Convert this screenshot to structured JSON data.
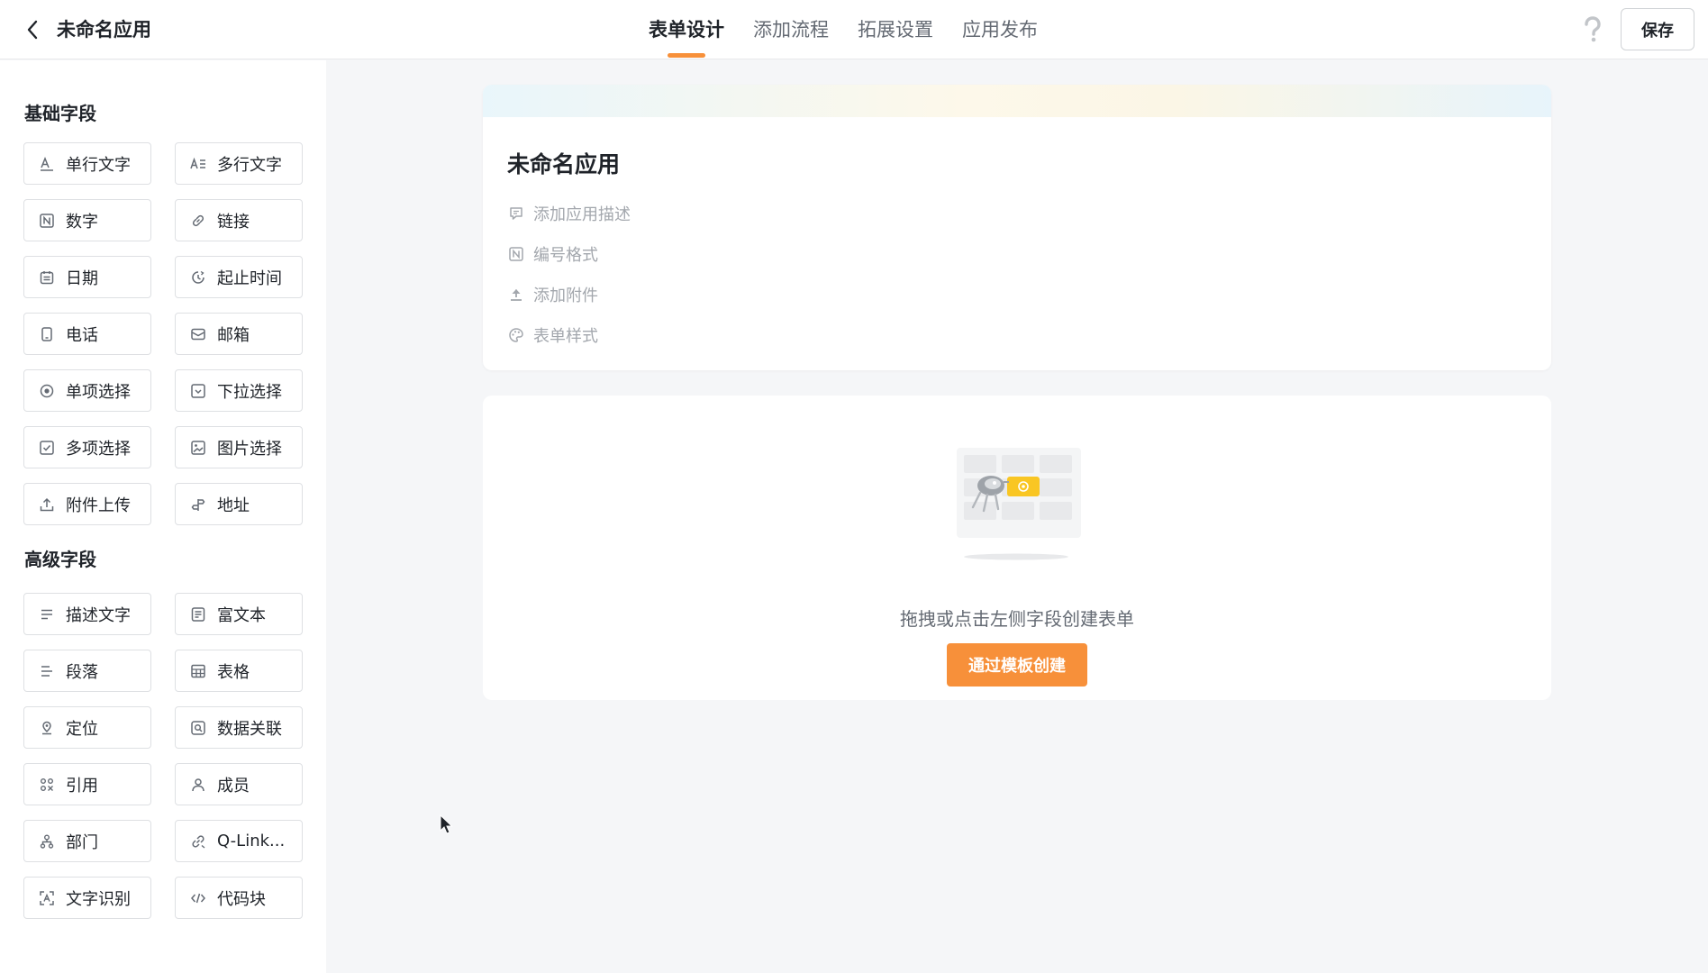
{
  "header": {
    "app_title": "未命名应用",
    "tabs": [
      {
        "label": "表单设计",
        "active": true
      },
      {
        "label": "添加流程",
        "active": false
      },
      {
        "label": "拓展设置",
        "active": false
      },
      {
        "label": "应用发布",
        "active": false
      }
    ],
    "save_label": "保存",
    "accent_color": "#f7903a"
  },
  "sidebar": {
    "basic_title": "基础字段",
    "basic_fields": [
      {
        "label": "单行文字",
        "icon": "single-line-text-icon"
      },
      {
        "label": "多行文字",
        "icon": "multi-line-text-icon"
      },
      {
        "label": "数字",
        "icon": "number-icon"
      },
      {
        "label": "链接",
        "icon": "link-icon"
      },
      {
        "label": "日期",
        "icon": "calendar-icon"
      },
      {
        "label": "起止时间",
        "icon": "time-range-icon"
      },
      {
        "label": "电话",
        "icon": "phone-icon"
      },
      {
        "label": "邮箱",
        "icon": "email-icon"
      },
      {
        "label": "单项选择",
        "icon": "radio-icon"
      },
      {
        "label": "下拉选择",
        "icon": "dropdown-icon"
      },
      {
        "label": "多项选择",
        "icon": "checkbox-icon"
      },
      {
        "label": "图片选择",
        "icon": "image-icon"
      },
      {
        "label": "附件上传",
        "icon": "upload-icon"
      },
      {
        "label": "地址",
        "icon": "address-icon"
      }
    ],
    "advanced_title": "高级字段",
    "advanced_fields": [
      {
        "label": "描述文字",
        "icon": "description-icon"
      },
      {
        "label": "富文本",
        "icon": "rich-text-icon"
      },
      {
        "label": "段落",
        "icon": "paragraph-icon"
      },
      {
        "label": "表格",
        "icon": "table-icon"
      },
      {
        "label": "定位",
        "icon": "location-icon"
      },
      {
        "label": "数据关联",
        "icon": "data-link-icon"
      },
      {
        "label": "引用",
        "icon": "reference-icon"
      },
      {
        "label": "成员",
        "icon": "member-icon"
      },
      {
        "label": "部门",
        "icon": "department-icon"
      },
      {
        "label": "Q-Link...",
        "icon": "q-link-icon"
      },
      {
        "label": "文字识别",
        "icon": "ocr-icon"
      },
      {
        "label": "代码块",
        "icon": "code-icon"
      }
    ]
  },
  "form": {
    "title": "未命名应用",
    "options": [
      {
        "label": "添加应用描述",
        "icon": "comment-icon"
      },
      {
        "label": "编号格式",
        "icon": "number-format-icon"
      },
      {
        "label": "添加附件",
        "icon": "attachment-upload-icon"
      },
      {
        "label": "表单样式",
        "icon": "palette-icon"
      }
    ]
  },
  "empty_state": {
    "hint": "拖拽或点击左侧字段创建表单",
    "template_button": "通过模板创建"
  }
}
